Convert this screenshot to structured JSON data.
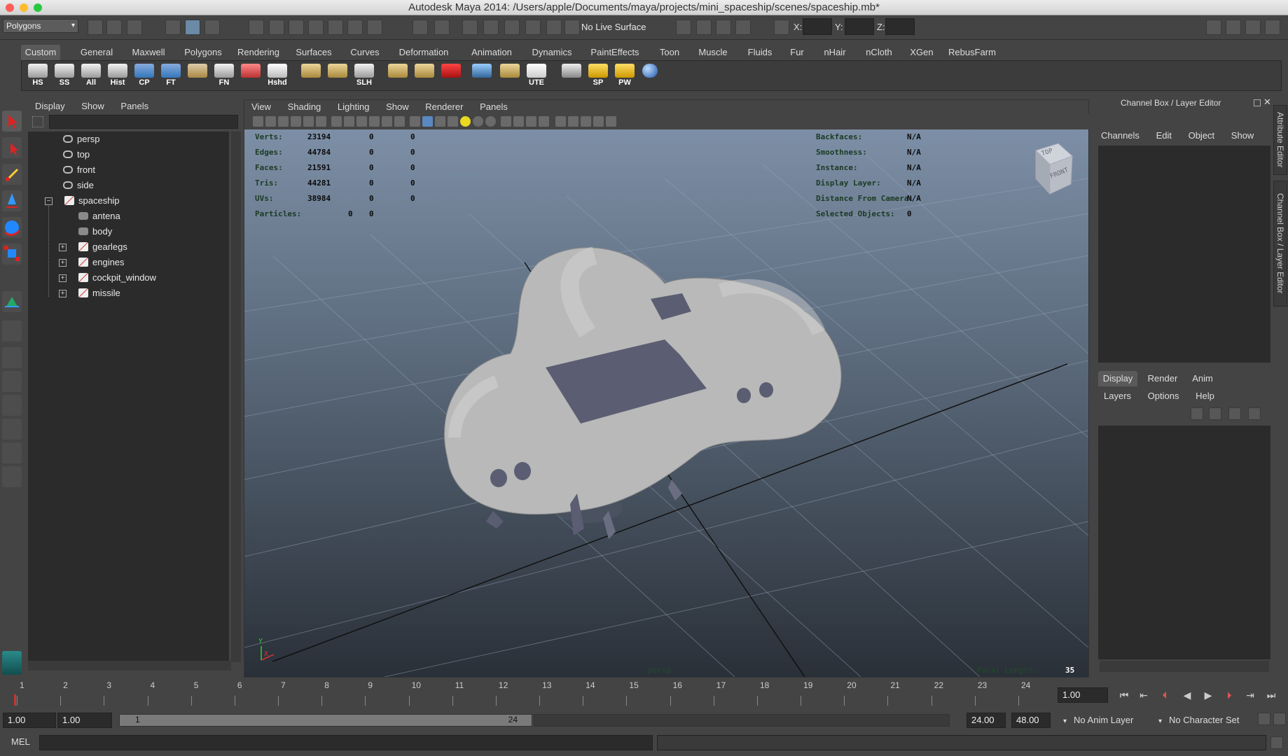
{
  "window": {
    "title": "Autodesk Maya 2014: /Users/apple/Documents/maya/projects/mini_spaceship/scenes/spaceship.mb*"
  },
  "statusline": {
    "mode": "Polygons",
    "live_surface": "No Live Surface",
    "x_label": "X:",
    "y_label": "Y:",
    "z_label": "Z:"
  },
  "shelf": {
    "tabs": [
      "Custom",
      "General",
      "Maxwell",
      "Polygons",
      "Rendering",
      "Surfaces",
      "Curves",
      "Deformation",
      "Animation",
      "Dynamics",
      "PaintEffects",
      "Toon",
      "Muscle",
      "Fluids",
      "Fur",
      "nHair",
      "nCloth",
      "XGen",
      "RebusFarm"
    ],
    "active_tab": "Custom",
    "buttons": [
      "HS",
      "SS",
      "All",
      "Hist",
      "CP",
      "FT",
      "",
      "FN",
      "",
      "Hshd",
      "",
      "",
      "SLH",
      "",
      "",
      "",
      "",
      "",
      "UTE",
      "",
      "SP",
      "PW",
      ""
    ]
  },
  "outliner": {
    "menu": [
      "Display",
      "Show",
      "Panels"
    ],
    "items": [
      {
        "label": "persp",
        "type": "camera",
        "level": 0
      },
      {
        "label": "top",
        "type": "camera",
        "level": 0
      },
      {
        "label": "front",
        "type": "camera",
        "level": 0
      },
      {
        "label": "side",
        "type": "camera",
        "level": 0
      },
      {
        "label": "spaceship",
        "type": "group",
        "level": 0,
        "expand": "−"
      },
      {
        "label": "antena",
        "type": "mesh",
        "level": 1
      },
      {
        "label": "body",
        "type": "mesh",
        "level": 1
      },
      {
        "label": "gearlegs",
        "type": "group",
        "level": 1,
        "expand": "+"
      },
      {
        "label": "engines",
        "type": "group",
        "level": 1,
        "expand": "+"
      },
      {
        "label": "cockpit_window",
        "type": "group",
        "level": 1,
        "expand": "+"
      },
      {
        "label": "missile",
        "type": "group",
        "level": 1,
        "expand": "+"
      }
    ]
  },
  "viewport": {
    "menu": [
      "View",
      "Shading",
      "Lighting",
      "Show",
      "Renderer",
      "Panels"
    ],
    "hud_left": [
      {
        "label": "Verts:",
        "v1": "23194",
        "v2": "0",
        "v3": "0"
      },
      {
        "label": "Edges:",
        "v1": "44784",
        "v2": "0",
        "v3": "0"
      },
      {
        "label": "Faces:",
        "v1": "21591",
        "v2": "0",
        "v3": "0"
      },
      {
        "label": "Tris:",
        "v1": "44281",
        "v2": "0",
        "v3": "0"
      },
      {
        "label": "UVs:",
        "v1": "38984",
        "v2": "0",
        "v3": "0"
      }
    ],
    "particles": {
      "label": "Particles:",
      "v1": "0",
      "v2": "0"
    },
    "hud_right": [
      {
        "label": "Backfaces:",
        "value": "N/A"
      },
      {
        "label": "Smoothness:",
        "value": "N/A"
      },
      {
        "label": "Instance:",
        "value": "N/A"
      },
      {
        "label": "Display Layer:",
        "value": "N/A"
      },
      {
        "label": "Distance From Camera:",
        "value": "N/A"
      },
      {
        "label": "Selected Objects:",
        "value": "0"
      }
    ],
    "viewcube": {
      "top": "TOP",
      "front": "FRONT"
    },
    "camera_name": "persp",
    "focal_label": "Focal Length:",
    "focal_value": "35",
    "axis": {
      "x": "X",
      "y": "Y"
    }
  },
  "channel_box": {
    "title": "Channel Box / Layer Editor",
    "menu": [
      "Channels",
      "Edit",
      "Object",
      "Show"
    ],
    "layer_tabs": [
      "Display",
      "Render",
      "Anim"
    ],
    "active_layer_tab": "Display",
    "layer_menu": [
      "Layers",
      "Options",
      "Help"
    ],
    "side_tabs": [
      "Attribute Editor",
      "Channel Box / Layer Editor"
    ]
  },
  "timeline": {
    "ticks": [
      "1",
      "2",
      "3",
      "4",
      "5",
      "6",
      "7",
      "8",
      "9",
      "10",
      "11",
      "12",
      "13",
      "14",
      "15",
      "16",
      "17",
      "18",
      "19",
      "20",
      "21",
      "22",
      "23",
      "24"
    ],
    "current_frame": "1.00"
  },
  "range": {
    "start": "1.00",
    "playback_start": "1.00",
    "slider_start": "1",
    "slider_end": "24",
    "playback_end": "24.00",
    "end": "48.00",
    "anim_layer": "No Anim Layer",
    "character_set": "No Character Set"
  },
  "commandline": {
    "label": "MEL"
  }
}
